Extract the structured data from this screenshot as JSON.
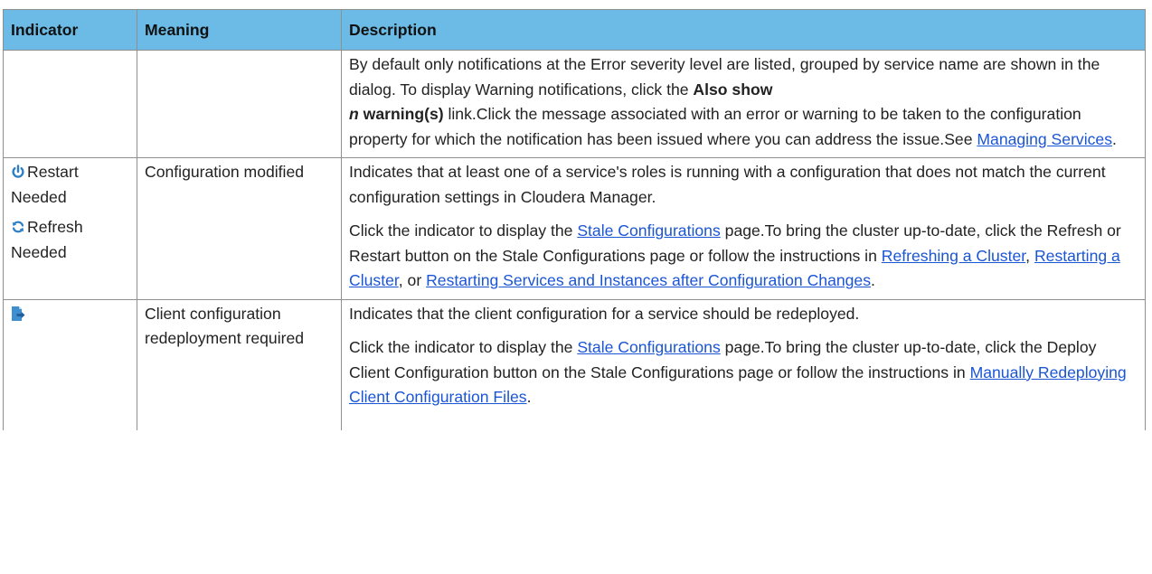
{
  "table": {
    "headers": [
      "Indicator",
      "Meaning",
      "Description"
    ],
    "row1": {
      "indicator": "",
      "meaning": "",
      "desc_part1": "By default only notifications at the Error severity level are listed, grouped by service name are shown in the dialog. To display Warning notifications, click the ",
      "desc_bold1": "Also show",
      "desc_bold_italic": "n",
      "desc_bold2": " warning(s)",
      "desc_part2": " link.Click the message associated with an error or warning to be taken to the configuration property for which the notification has been issued where you can address the issue.See ",
      "link_managing_services": "Managing Services",
      "desc_end": "."
    },
    "row2": {
      "indicator_restart_icon": "power-icon",
      "indicator_restart": "Restart Needed",
      "indicator_refresh_icon": "refresh-icon",
      "indicator_refresh": "Refresh Needed",
      "meaning": "Configuration modified",
      "p1": "Indicates that at least one of a service's roles is running with a configuration that does not match the current configuration settings in Cloudera Manager.",
      "p2_part1": "Click the indicator to display the ",
      "link_stale_configurations": "Stale Configurations",
      "p2_part2": " page.To bring the cluster up-to-date, click the Refresh or Restart button on the Stale Configurations page or follow the instructions in ",
      "link_refreshing_cluster": "Refreshing a Cluster",
      "p2_sep1": ", ",
      "link_restarting_cluster": "Restarting a Cluster",
      "p2_sep2": ", or ",
      "link_restarting_services": "Restarting Services and Instances after Configuration Changes",
      "p2_end": "."
    },
    "row3": {
      "indicator_icon": "client-config-deploy-icon",
      "meaning": "Client configuration redeployment required",
      "p1": "Indicates that the client configuration for a service should be redeployed.",
      "p2_part1": "Click the indicator to display the ",
      "link_stale_configurations": "Stale Configurations",
      "p2_part2": " page.To bring the cluster up-to-date, click the Deploy Client Configuration button on the Stale Configurations page or follow the instructions in ",
      "link_manually_redeploying": "Manually Redeploying Client Configuration Files",
      "p2_end": "."
    }
  },
  "colors": {
    "header_bg": "#6bbbe6",
    "link": "#1a55d6",
    "icon_blue": "#2f7fc4",
    "border": "#8f8f8f"
  }
}
